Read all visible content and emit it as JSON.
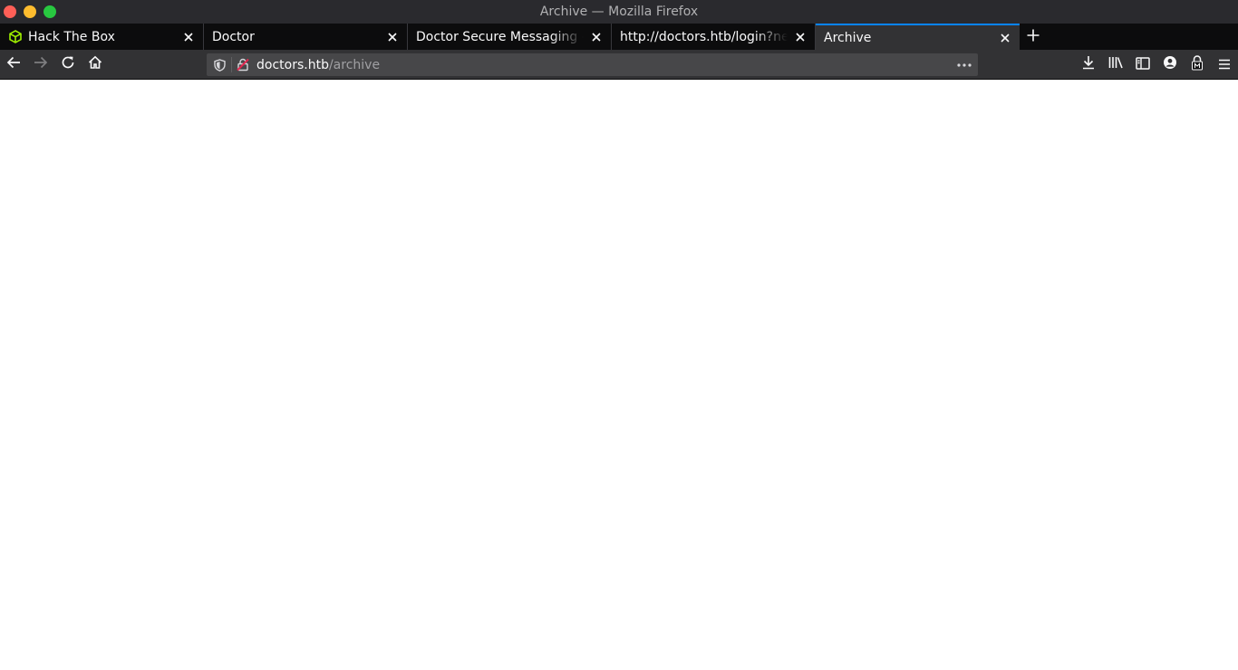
{
  "window": {
    "title": "Archive — Mozilla Firefox"
  },
  "tabs": [
    {
      "label": "Hack The Box",
      "icon": "htb-cube-icon",
      "active": false
    },
    {
      "label": "Doctor",
      "icon": "",
      "active": false
    },
    {
      "label": "Doctor Secure Messaging - L",
      "icon": "",
      "active": false
    },
    {
      "label": "http://doctors.htb/login?next",
      "icon": "",
      "active": false
    },
    {
      "label": "Archive",
      "icon": "",
      "active": true
    }
  ],
  "urlbar": {
    "host": "doctors.htb",
    "path": "/archive"
  },
  "colors": {
    "titlebar": "#2a2a2e",
    "tabstrip": "#0c0c0d",
    "toolbar": "#323234",
    "urlbar": "#474749",
    "active_tab_accent": "#0a84ff",
    "htb_green": "#9fef00"
  }
}
